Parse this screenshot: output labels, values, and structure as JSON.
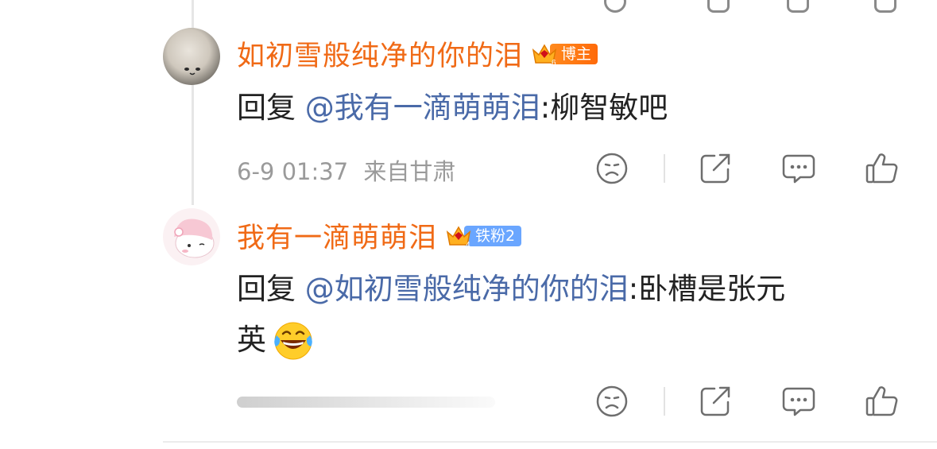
{
  "comments": [
    {
      "username": "如初雪般纯净的你的泪",
      "badge": {
        "level": "6",
        "label": "博主",
        "color": "#ff7a12"
      },
      "reply_prefix": "回复",
      "mention": "@我有一滴萌萌泪",
      "text": ":柳智敏吧",
      "time": "6-9 01:37",
      "location": "来自甘肃",
      "avatar_icon": "white-cat-face-avatar"
    },
    {
      "username": "我有一滴萌萌泪",
      "badge": {
        "level": "4",
        "label": "铁粉2",
        "color": "#6aa6ff"
      },
      "reply_prefix": "回复",
      "mention": "@如初雪般纯净的你的泪",
      "text_line1": ":卧槽是张元",
      "text_line2": "英",
      "emoji": "laughing-tears-emoji",
      "avatar_icon": "my-melody-avatar"
    }
  ],
  "actions": [
    "dislike-icon",
    "share-icon",
    "comment-icon",
    "like-icon"
  ],
  "colors": {
    "username": "#f06a16",
    "mention": "#4a6aa8",
    "meta": "#9a9a9a"
  }
}
